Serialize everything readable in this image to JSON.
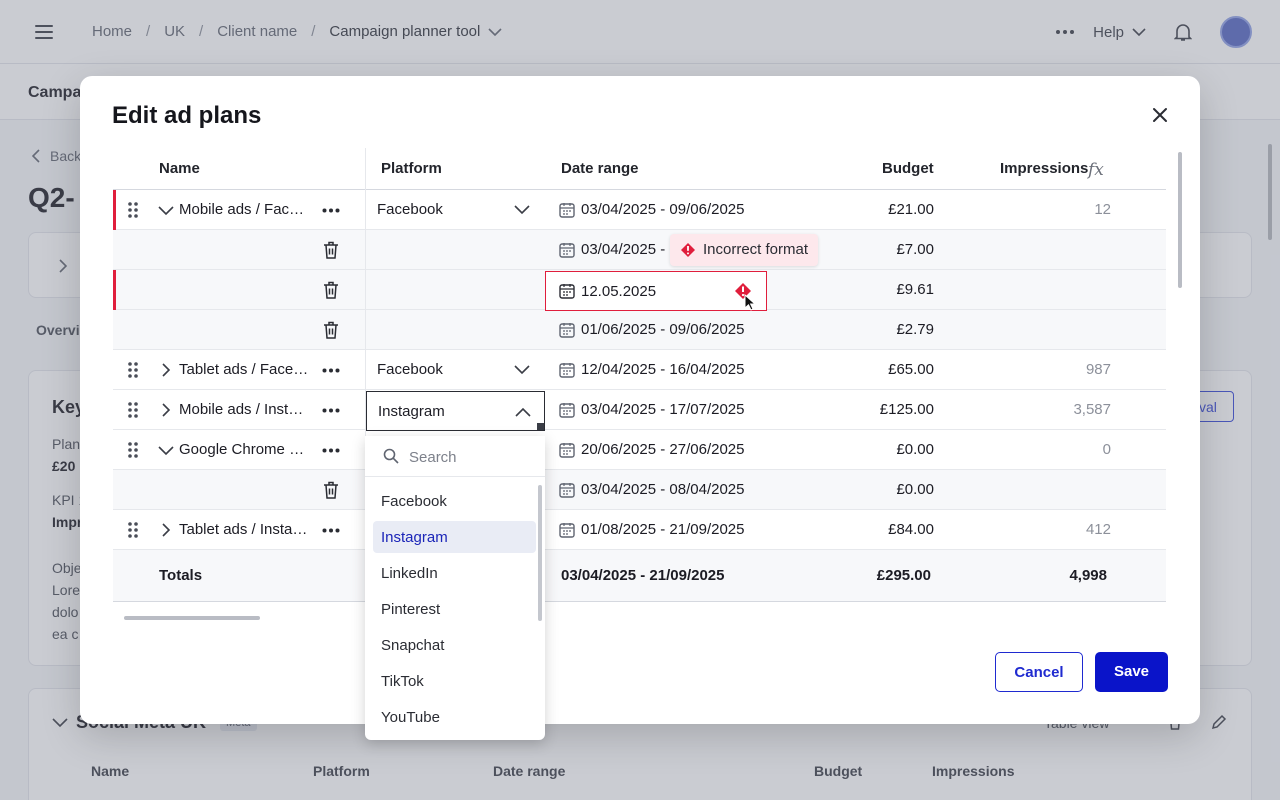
{
  "breadcrumb": {
    "items": [
      "Home",
      "UK",
      "Client name"
    ],
    "current": "Campaign planner tool"
  },
  "header": {
    "help_label": "Help"
  },
  "background": {
    "subnav_title": "Campa",
    "back_label": "Back",
    "page_title": "Q2-",
    "tab_label": "Overvi",
    "key_heading": "Key",
    "plan_label": "Plan",
    "plan_value": "£20",
    "kpi_label": "KPI 1",
    "kpi_value": "Impr",
    "objective_label": "Obje",
    "lorem_1": "Lore",
    "lorem_2": "dolo",
    "lorem_3": "ea c",
    "approval_label": "val",
    "section_title": "Social Meta UK",
    "section_tag": "Meta",
    "table_view_label": "Table view",
    "cols": [
      "Name",
      "Platform",
      "Date range",
      "Budget",
      "Impressions"
    ]
  },
  "modal": {
    "title": "Edit ad plans",
    "columns": {
      "name": "Name",
      "platform": "Platform",
      "date_range": "Date range",
      "budget": "Budget",
      "impressions": "Impressions"
    },
    "rows": [
      {
        "name": "Mobile ads / Facebook",
        "platform": "Facebook",
        "date_range": "03/04/2025 - 09/06/2025",
        "budget": "£21.00",
        "impressions": "12"
      },
      {
        "date_range": "03/04/2025 - 0",
        "budget": "£7.00"
      },
      {
        "date_range": "12.05.2025",
        "budget": "£9.61"
      },
      {
        "date_range": "01/06/2025 - 09/06/2025",
        "budget": "£2.79"
      },
      {
        "name": "Tablet ads / Facebook",
        "platform": "Facebook",
        "date_range": "12/04/2025 - 16/04/2025",
        "budget": "£65.00",
        "impressions": "987"
      },
      {
        "name": "Mobile ads / Instagram",
        "platform": "Instagram",
        "date_range": "03/04/2025 - 17/07/2025",
        "budget": "£125.00",
        "impressions": "3,587"
      },
      {
        "name": "Google Chrome ads",
        "date_range": "20/06/2025 - 27/06/2025",
        "budget": "£0.00",
        "impressions": "0"
      },
      {
        "date_range": "03/04/2025 - 08/04/2025",
        "budget": "£0.00"
      },
      {
        "name": "Tablet ads / Instagram",
        "date_range": "01/08/2025 - 21/09/2025",
        "budget": "£84.00",
        "impressions": "412"
      }
    ],
    "totals": {
      "label": "Totals",
      "date_range": "03/04/2025 - 21/09/2025",
      "budget": "£295.00",
      "impressions": "4,998"
    },
    "error_tooltip": "Incorrect format",
    "cancel_label": "Cancel",
    "save_label": "Save"
  },
  "dropdown": {
    "search_placeholder": "Search",
    "options": [
      "Facebook",
      "Instagram",
      "LinkedIn",
      "Pinterest",
      "Snapchat",
      "TikTok",
      "YouTube"
    ],
    "selected": "Instagram"
  },
  "colors": {
    "accent": "#0a14c9",
    "error": "#e01e3c",
    "selected_bg": "#e9ecf5"
  },
  "icons": [
    "menu-icon",
    "chevron-down-icon",
    "more-icon",
    "bell-icon",
    "close-icon",
    "drag-handle-icon",
    "chevron-right-icon",
    "trash-icon",
    "calendar-icon",
    "error-icon",
    "search-icon",
    "edit-icon",
    "function-icon"
  ]
}
